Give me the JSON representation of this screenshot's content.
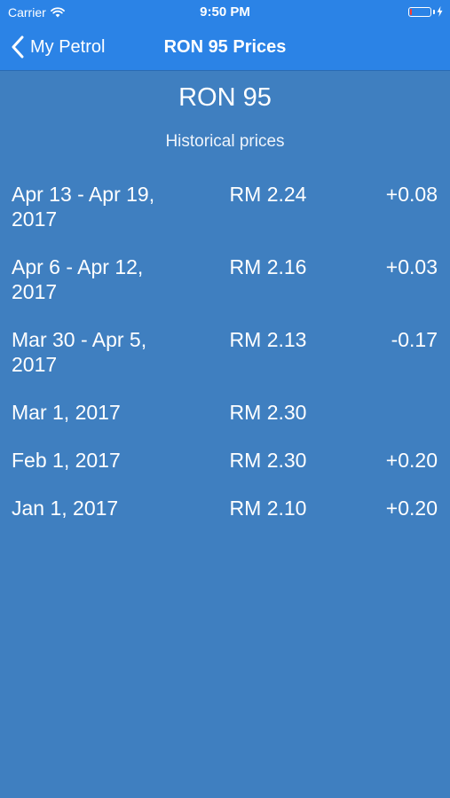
{
  "status_bar": {
    "carrier": "Carrier",
    "time": "9:50 PM",
    "wifi_icon": "wifi-icon",
    "battery_icon": "battery-icon",
    "charging_icon": "bolt-icon"
  },
  "nav": {
    "back_label": "My Petrol",
    "back_icon": "chevron-left-icon",
    "title": "RON 95 Prices",
    "background_color": "#2b83e6"
  },
  "main": {
    "title": "RON 95",
    "subtitle": "Historical prices",
    "background_color": "#3f7fc0",
    "rows": [
      {
        "date": "Apr 13 - Apr 19, 2017",
        "price": "RM 2.24",
        "change": "+0.08"
      },
      {
        "date": "Apr 6 - Apr 12, 2017",
        "price": "RM 2.16",
        "change": "+0.03"
      },
      {
        "date": "Mar 30 - Apr 5, 2017",
        "price": "RM 2.13",
        "change": "-0.17"
      },
      {
        "date": "Mar 1, 2017",
        "price": "RM 2.30",
        "change": ""
      },
      {
        "date": "Feb 1, 2017",
        "price": "RM 2.30",
        "change": "+0.20"
      },
      {
        "date": "Jan 1, 2017",
        "price": "RM 2.10",
        "change": "+0.20"
      }
    ]
  }
}
